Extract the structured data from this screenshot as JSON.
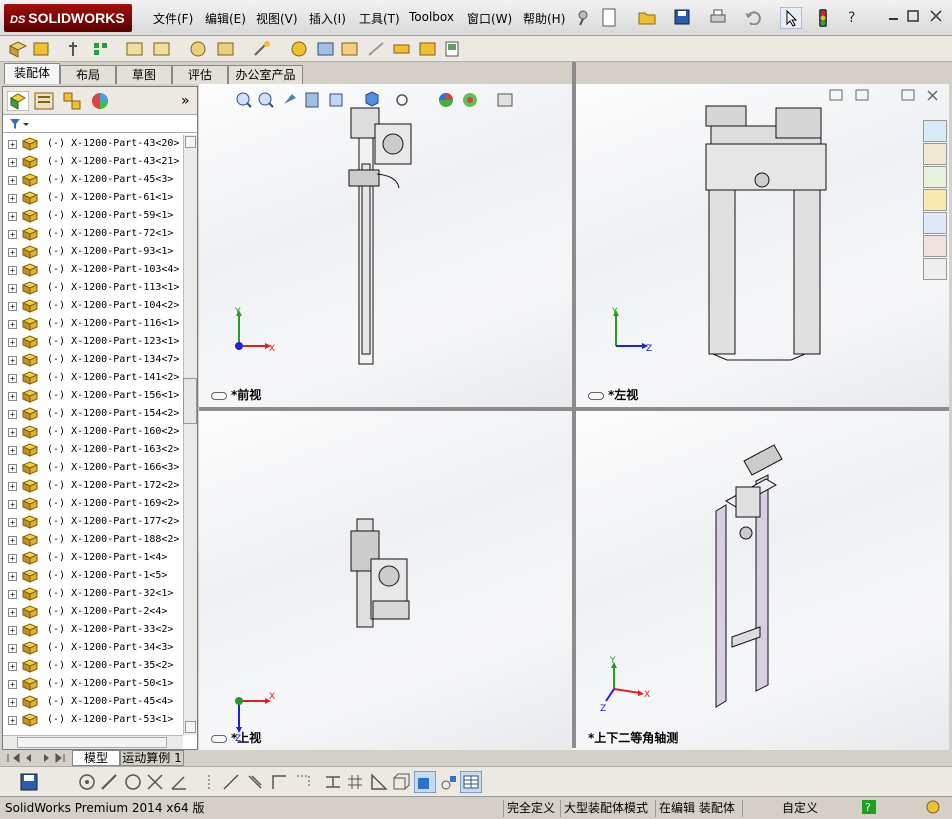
{
  "app": {
    "logo_prefix": "DS",
    "logo_text": "SOLIDWORKS"
  },
  "menu": [
    "文件(F)",
    "编辑(E)",
    "视图(V)",
    "插入(I)",
    "工具(T)",
    "Toolbox",
    "窗口(W)",
    "帮助(H)"
  ],
  "command_tabs": [
    "装配体",
    "布局",
    "草图",
    "评估",
    "办公室产品"
  ],
  "tree": {
    "expand_glyph": "+",
    "items": [
      "(-) X-1200-Part-43<20>",
      "(-) X-1200-Part-43<21>",
      "(-) X-1200-Part-45<3>",
      "(-) X-1200-Part-61<1>",
      "(-) X-1200-Part-59<1>",
      "(-) X-1200-Part-72<1>",
      "(-) X-1200-Part-93<1>",
      "(-) X-1200-Part-103<4>",
      "(-) X-1200-Part-113<1>",
      "(-) X-1200-Part-104<2>",
      "(-) X-1200-Part-116<1>",
      "(-) X-1200-Part-123<1>",
      "(-) X-1200-Part-134<7>",
      "(-) X-1200-Part-141<2>",
      "(-) X-1200-Part-156<1>",
      "(-) X-1200-Part-154<2>",
      "(-) X-1200-Part-160<2>",
      "(-) X-1200-Part-163<2>",
      "(-) X-1200-Part-166<3>",
      "(-) X-1200-Part-172<2>",
      "(-) X-1200-Part-169<2>",
      "(-) X-1200-Part-177<2>",
      "(-) X-1200-Part-188<2>",
      "(-) X-1200-Part-1<4>",
      "(-) X-1200-Part-1<5>",
      "(-) X-1200-Part-32<1>",
      "(-) X-1200-Part-2<4>",
      "(-) X-1200-Part-33<2>",
      "(-) X-1200-Part-34<3>",
      "(-) X-1200-Part-35<2>",
      "(-) X-1200-Part-50<1>",
      "(-) X-1200-Part-45<4>",
      "(-) X-1200-Part-53<1>"
    ]
  },
  "bottom_tabs": [
    "模型",
    "运动算例 1"
  ],
  "views": {
    "front": "*前视",
    "left": "*左视",
    "top": "*上视",
    "iso": "*上下二等角轴测"
  },
  "axes": {
    "x": "X",
    "y": "Y",
    "z": "Z"
  },
  "status": {
    "version": "SolidWorks Premium 2014 x64 版",
    "fully_defined": "完全定义",
    "large_mode": "大型装配体模式",
    "editing": "在编辑 装配体",
    "custom": "自定义"
  },
  "colors": {
    "axis_x": "#e02020",
    "axis_y": "#20a020",
    "axis_z": "#2020e0",
    "logo": "#8a0e0e"
  }
}
